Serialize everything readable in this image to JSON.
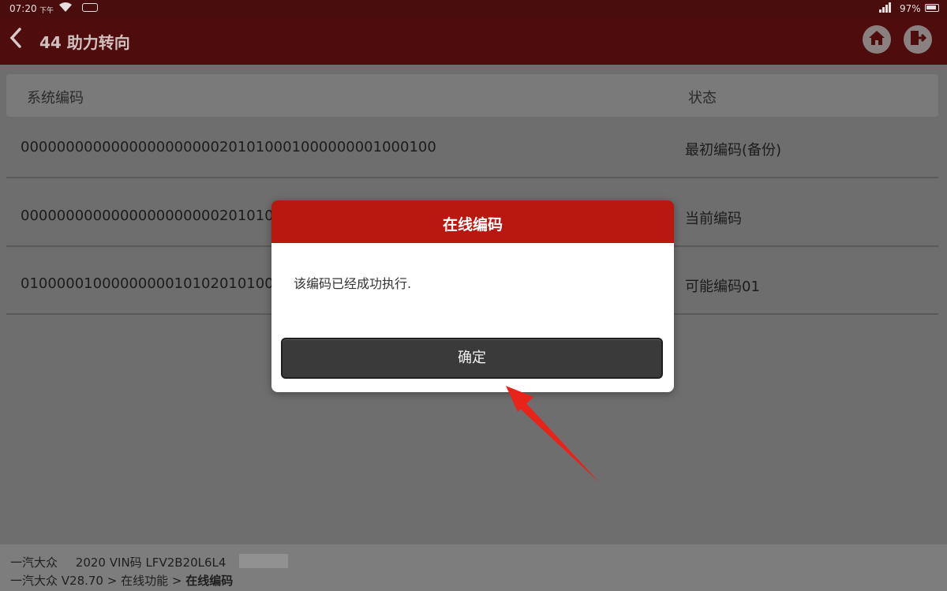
{
  "status_bar": {
    "time": "07:20",
    "ampm": "下午",
    "battery": "97%"
  },
  "header": {
    "back": "‹",
    "title": "44 助力转向",
    "home_icon": "home-icon",
    "exit_icon": "exit-icon"
  },
  "table": {
    "headers": [
      "系统编码",
      "状态"
    ],
    "rows": [
      {
        "code": "0000000000000000000000201010001000000001000100",
        "status": "最初编码(备份)"
      },
      {
        "code": "000000000000000000000020101000",
        "status": "当前编码"
      },
      {
        "code": "010000010000000001010201010001",
        "status": "可能编码01"
      }
    ]
  },
  "dialog": {
    "title": "在线编码",
    "message": "该编码已经成功执行.",
    "ok_label": "确定"
  },
  "footer": {
    "make": "一汽大众",
    "year": "2020",
    "vin_label": "VIN码",
    "vin": "LFV2B20L6L4",
    "breadcrumb_root": "一汽大众 V28.70",
    "sep1": ">",
    "breadcrumb_mid": "在线功能",
    "sep2": ">",
    "breadcrumb_current": "在线编码"
  },
  "colors": {
    "header_bg": "#4f0c0c",
    "dialog_title_bg": "#b8180f",
    "arrow": "#e8231a"
  }
}
